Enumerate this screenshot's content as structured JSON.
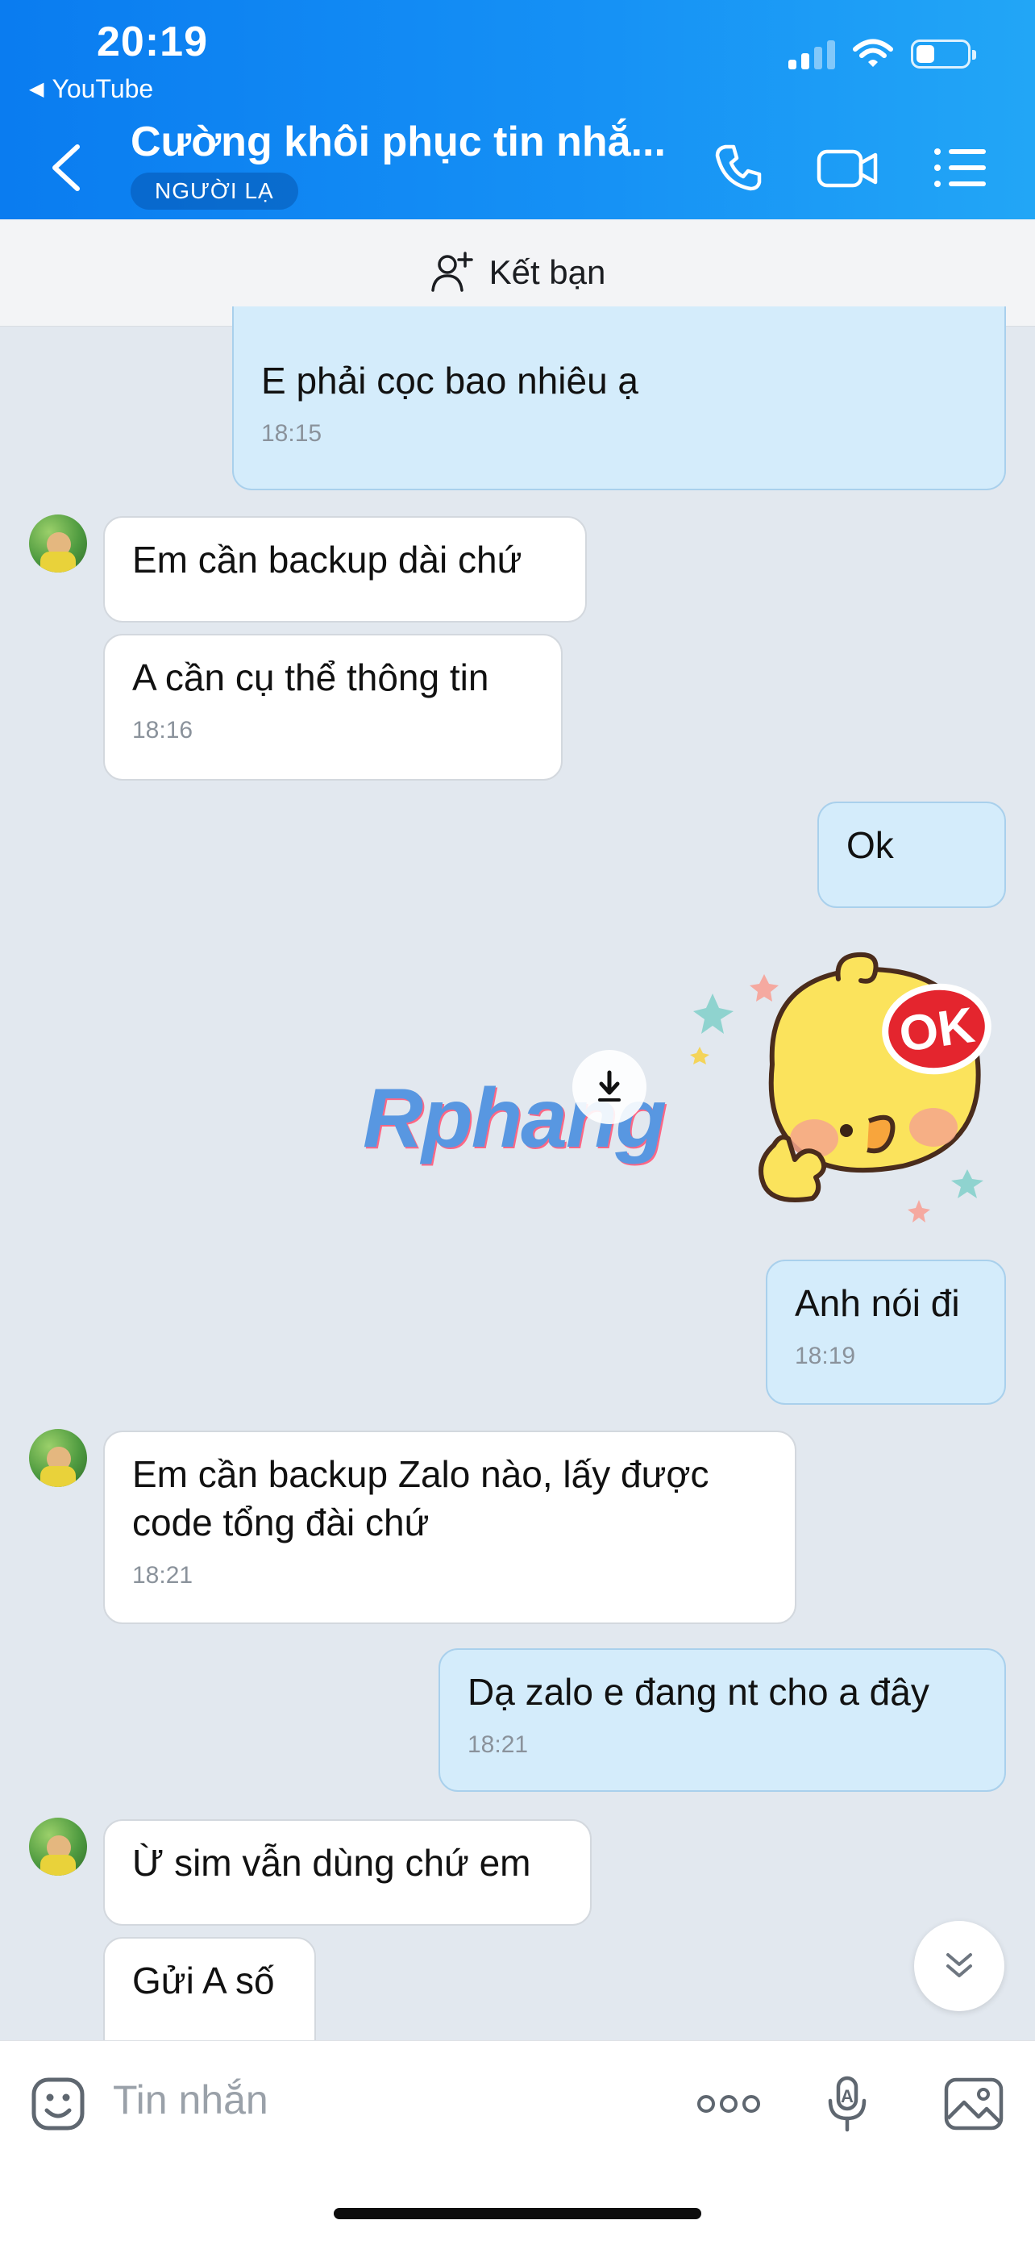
{
  "status_bar": {
    "time": "20:19",
    "back_app": "YouTube"
  },
  "header": {
    "title": "Cường khôi phục tin nhắ...",
    "tag": "NGƯỜI LẠ",
    "icons": [
      "back-icon",
      "phone-icon",
      "video-call-icon",
      "menu-list-icon"
    ]
  },
  "friend_bar": {
    "label": "Kết bạn",
    "icon": "add-friend-icon"
  },
  "messages": [
    {
      "dir": "out",
      "text": "E phải cọc bao nhiêu ạ",
      "time": "18:15"
    },
    {
      "dir": "in",
      "text": "Em cần backup dài chứ",
      "time": ""
    },
    {
      "dir": "in",
      "text": "A cần cụ thể thông tin",
      "time": "18:16"
    },
    {
      "dir": "out",
      "text": "Ok",
      "time": ""
    },
    {
      "dir": "out",
      "type": "sticker",
      "text": "OK"
    },
    {
      "dir": "out",
      "text": "Anh nói đi",
      "time": "18:19"
    },
    {
      "dir": "in",
      "text": "Em cần backup Zalo nào, lấy được code tổng đài chứ",
      "time": "18:21"
    },
    {
      "dir": "out",
      "text": "Dạ zalo e đang nt cho a đây",
      "time": "18:21"
    },
    {
      "dir": "in",
      "text": "Ừ sim vẫn dùng chứ em",
      "time": ""
    },
    {
      "dir": "in",
      "text": "Gửi A số",
      "time": ""
    }
  ],
  "watermark": "Rphang",
  "composer": {
    "placeholder": "Tin nhắn",
    "icons": [
      "emoji-icon",
      "more-icon",
      "voice-text-icon",
      "image-icon"
    ]
  },
  "colors": {
    "header_start": "#0a7cf0",
    "header_end": "#22a6f6",
    "chat_bg": "#e2e8ef",
    "outgoing_bubble": "#d4ecfb",
    "incoming_bubble": "#ffffff"
  }
}
